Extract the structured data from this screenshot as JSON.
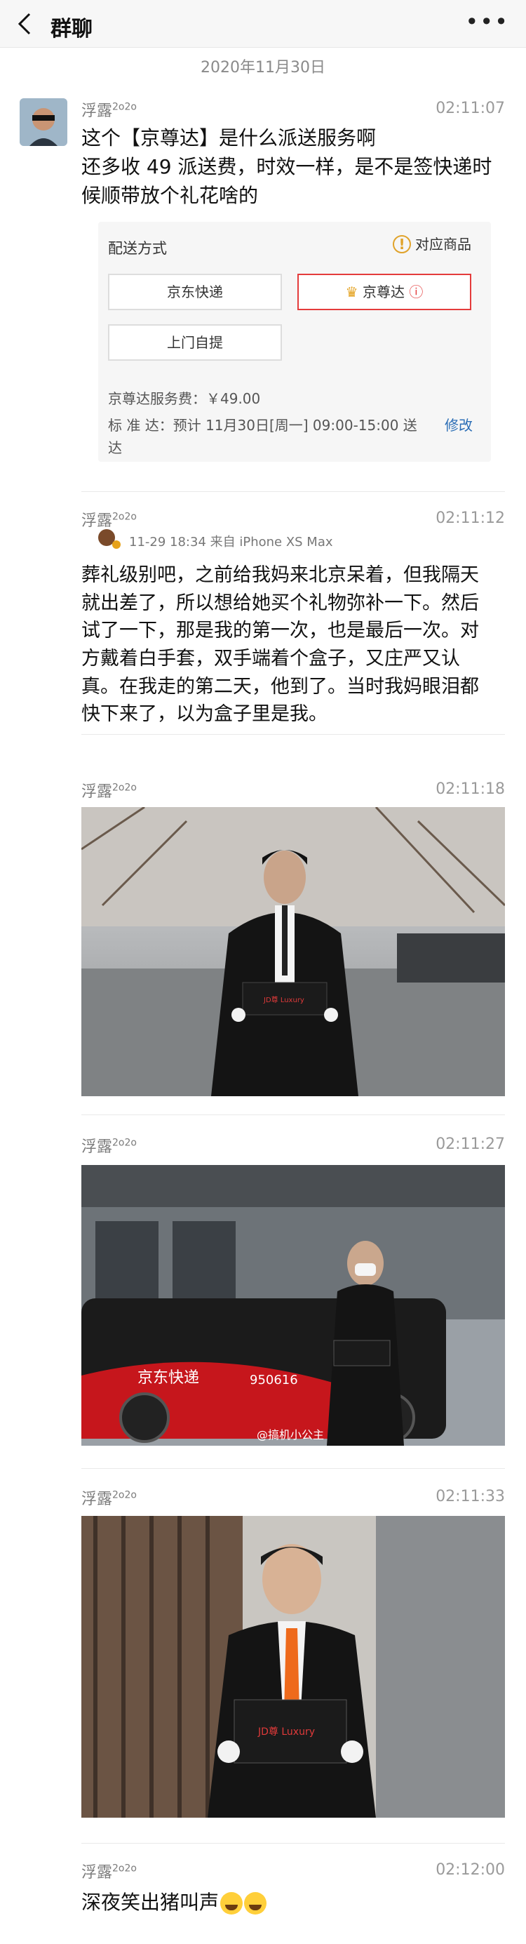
{
  "header": {
    "title": "群聊",
    "back_icon": "chevron-left-icon",
    "more_icon": "more-dots-icon",
    "more_text": "•••"
  },
  "date": "2020年11月30日",
  "messages": [
    {
      "sender": "浮露",
      "sender_sup": "2o2o",
      "time": "02:11:07",
      "text": "这个【京尊达】是什么派送服务啊\n还多收 49 派送费，时效一样，是不是签快递时候顺带放个礼花啥的"
    },
    {
      "sender": "浮露",
      "sender_sup": "2o2o",
      "time": "02:11:12",
      "text": "葬礼级别吧，之前给我妈来北京呆着，但我隔天就出差了，所以想给她买个礼物弥补一下。然后试了一下，那是我的第一次，也是最后一次。对方戴着白手套，双手端着个盒子，又庄严又认真。在我走的第二天，他到了。当时我妈眼泪都快下来了，以为盒子里是我。"
    },
    {
      "sender": "浮露",
      "sender_sup": "2o2o",
      "time": "02:11:18"
    },
    {
      "sender": "浮露",
      "sender_sup": "2o2o",
      "time": "02:11:27"
    },
    {
      "sender": "浮露",
      "sender_sup": "2o2o",
      "time": "02:11:33"
    },
    {
      "sender": "浮露",
      "sender_sup": "2o2o",
      "time": "02:12:00",
      "text": "深夜笑出猪叫声"
    }
  ],
  "order_card": {
    "label": "配送方式",
    "warn_text": "对应商品",
    "option1": "京东快递",
    "option2": "京尊达",
    "option3": "上门自提",
    "fee": "京尊达服务费：￥49.00",
    "standard": "标 准 达：预计 11月30日[周一] 09:00-15:00 送达",
    "edit": "修改"
  },
  "repost_header": "11-29 18:34  来自 iPhone XS Max",
  "photos": {
    "p2_van_text": "京东快递",
    "p2_phone": "950616",
    "p2_watermark": "@搞机小公主",
    "box_label": "JD尊 Luxury"
  },
  "colors": {
    "accent_red": "#e43b3b",
    "link_blue": "#2d6fb6",
    "bg": "#ffffff"
  }
}
